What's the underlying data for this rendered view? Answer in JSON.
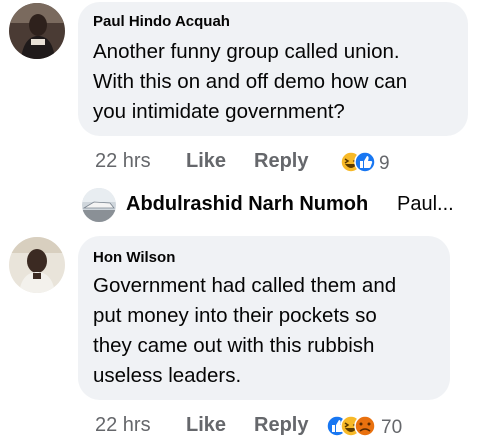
{
  "comments": [
    {
      "author": "Paul Hindo Acquah",
      "lines": [
        "Another funny group called union.",
        "With this on and off demo how can",
        "you intimidate  government?"
      ],
      "time": "22 hrs",
      "like_label": "Like",
      "reply_label": "Reply",
      "reaction_count": "9",
      "reaction_icons": [
        "haha-icon",
        "like-icon"
      ]
    },
    {
      "author": "Hon Wilson",
      "lines": [
        "Government had called them and",
        "put money into their pockets so",
        "they came out with this rubbish",
        "useless leaders."
      ],
      "time": "22 hrs",
      "like_label": "Like",
      "reply_label": "Reply",
      "reaction_count": "70",
      "reaction_icons": [
        "like-icon",
        "haha-icon",
        "sad-icon"
      ]
    }
  ],
  "reply_preview": {
    "author": "Abdulrashid Narh Numoh",
    "snippet": "Paul..."
  },
  "colors": {
    "bubble": "#f0f2f5",
    "meta": "#65676b",
    "text": "#050505",
    "like_blue": "#1877f2",
    "haha_yellow": "#f7b928",
    "sad_red": "#e9710f"
  }
}
